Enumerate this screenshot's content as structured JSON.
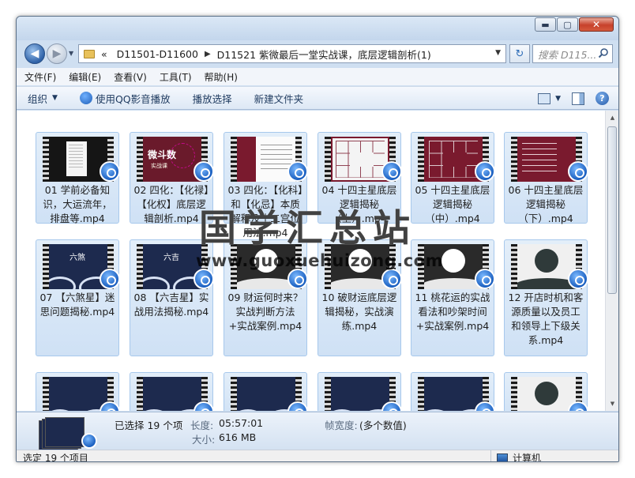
{
  "window": {
    "buttons": {
      "minimize": "▬",
      "maximize": "▢",
      "close": "✕"
    }
  },
  "nav": {
    "breadcrumb_overflow": "«",
    "breadcrumb": [
      "D11501-D11600",
      "D11521 紫微最后一堂实战课，底层逻辑剖析(1)"
    ],
    "search_placeholder": "搜索 D115..."
  },
  "menu": [
    "文件(F)",
    "编辑(E)",
    "查看(V)",
    "工具(T)",
    "帮助(H)"
  ],
  "toolbar": {
    "organize": "组织",
    "qq_play": "使用QQ影音播放",
    "play_selection": "播放选择",
    "new_folder": "新建文件夹"
  },
  "files": [
    {
      "name": "01 学前必备知识，大运流年，排盘等.mp4",
      "thumb": "dark-doc"
    },
    {
      "name": "02 四化：【化禄】【化权】底层逻辑剖析.mp4",
      "thumb": "maroon-title"
    },
    {
      "name": "03 四化：【化科】和【化忌】本质解释及十二宫位用法.mp4",
      "thumb": "slide"
    },
    {
      "name": "04 十四主星底层逻辑揭秘（上）.mp4",
      "thumb": "grid-light"
    },
    {
      "name": "05 十四主星底层逻辑揭秘（中）.mp4",
      "thumb": "grid-maroon"
    },
    {
      "name": "06 十四主星底层逻辑揭秘（下）.mp4",
      "thumb": "maroon-lines"
    },
    {
      "name": "07 【六煞星】迷思问题揭秘.mp4",
      "thumb": "navy"
    },
    {
      "name": "08 【六吉星】实战用法揭秘.mp4",
      "thumb": "navy"
    },
    {
      "name": "09 财运何时来？实战判断方法+实战案例.mp4",
      "thumb": "ink"
    },
    {
      "name": "10 破财运底层逻辑揭秘，实战演练.mp4",
      "thumb": "ink"
    },
    {
      "name": "11 桃花运的实战看法和吵架时间+实战案例.mp4",
      "thumb": "ink"
    },
    {
      "name": "12 开店时机和客源质量以及员工和领导上下级关系.mp4",
      "thumb": "ink-light"
    },
    {
      "name": "",
      "thumb": "navy"
    },
    {
      "name": "",
      "thumb": "navy"
    },
    {
      "name": "",
      "thumb": "navy"
    },
    {
      "name": "",
      "thumb": "navy"
    },
    {
      "name": "",
      "thumb": "navy"
    },
    {
      "name": "",
      "thumb": "ink-light"
    }
  ],
  "thumb_texts": {
    "02": "微斗数",
    "02_sub": "实战课",
    "07": "六煞",
    "08": "六吉"
  },
  "watermark": {
    "title": "国学汇总站",
    "url": "www.guoxuehuizong.com"
  },
  "details": {
    "selected": "已选择 19 个项",
    "length_label": "长度:",
    "length_value": "05:57:01",
    "size_label": "大小:",
    "size_value": "616 MB",
    "framewidth_label": "帧宽度:",
    "framewidth_value": "(多个数值)"
  },
  "status": {
    "left": "选定 19 个项目",
    "right": "计算机"
  },
  "colors": {
    "accent": "#1a5fc0",
    "window_frame": "#cfdff1"
  }
}
